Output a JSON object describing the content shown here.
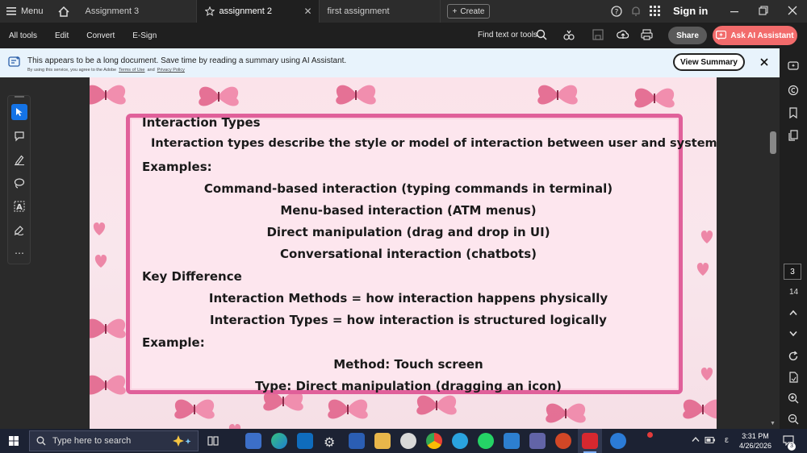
{
  "titlebar": {
    "menu_label": "Menu",
    "tabs": [
      {
        "label": "Assignment 3"
      },
      {
        "label": "assignment 2"
      },
      {
        "label": "first assignment"
      }
    ],
    "create_label": "Create",
    "signin_label": "Sign in"
  },
  "toolbar": {
    "items": [
      "All tools",
      "Edit",
      "Convert",
      "E-Sign"
    ],
    "find_label": "Find text or tools",
    "share_label": "Share",
    "ai_label": "Ask AI Assistant"
  },
  "banner": {
    "message": "This appears to be a long document. Save time by reading a summary using AI Assistant.",
    "fine_print_prefix": "By using this service, you agree to the Adobe",
    "terms_label": "Terms of Use",
    "and_label": "and",
    "privacy_label": "Privacy Policy",
    "view_summary_label": "View Summary"
  },
  "document": {
    "heading": "Interaction Types",
    "intro": "Interaction types describe the style or model of interaction between user and system.",
    "examples_heading": "Examples:",
    "examples": [
      "Command-based interaction (typing commands in terminal)",
      "Menu-based interaction (ATM menus)",
      "Direct manipulation (drag and drop in UI)",
      "Conversational interaction (chatbots)"
    ],
    "key_diff_heading": "Key Difference",
    "key_diff": [
      "Interaction Methods = how interaction happens physically",
      "Interaction Types = how interaction is structured logically"
    ],
    "example_heading": "Example:",
    "example_lines": [
      "Method: Touch screen",
      "Type: Direct manipulation (dragging an icon)"
    ]
  },
  "pager": {
    "current_page": "3",
    "total_pages": "14"
  },
  "taskbar": {
    "search_placeholder": "Type here to search",
    "time": "3:31 PM",
    "date": "4/26/2026",
    "notification_count": "3",
    "lang": "ε"
  },
  "colors": {
    "frame_border": "#e0609a",
    "ai_button": "#f26b6b",
    "banner_bg": "#e8f3fc",
    "taskbar_bg": "#1c2233"
  }
}
